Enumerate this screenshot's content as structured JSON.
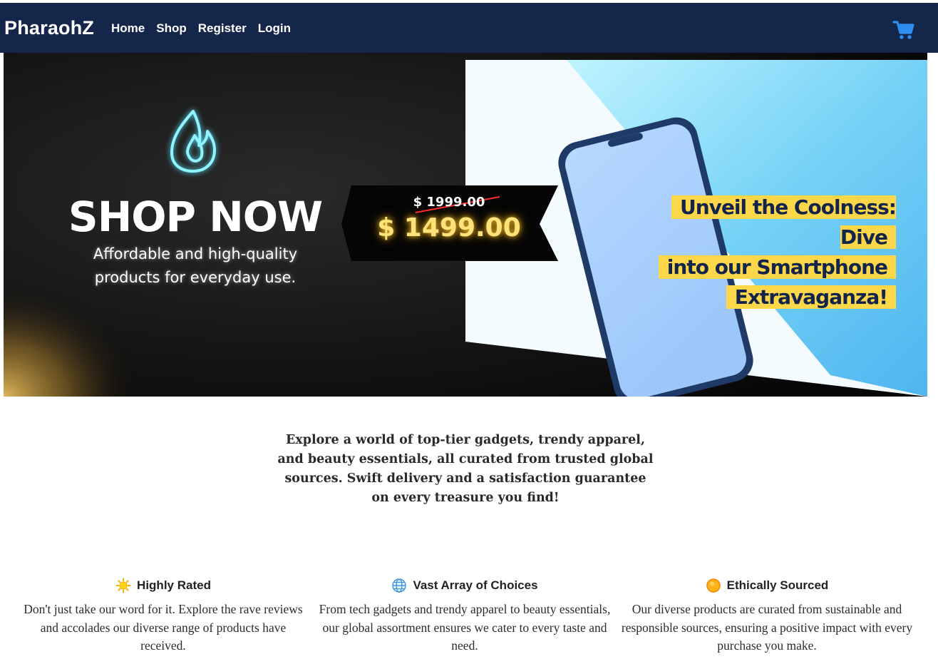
{
  "navbar": {
    "brand": "PharaohZ",
    "links": [
      "Home",
      "Shop",
      "Register",
      "Login"
    ],
    "cart_icon": "shopping-cart-icon",
    "background": "#14274a",
    "cart_color": "#2e8df1"
  },
  "hero": {
    "flame_icon": "flame-neon-icon",
    "heading": "SHOP NOW",
    "subtitle_lines": [
      "Affordable and high-quality",
      "products for everyday use."
    ],
    "old_price": "$ 1999.00",
    "new_price": "$ 1499.00",
    "promo_lines": [
      "Unveil the Coolness: Dive",
      "into our Smartphone",
      "Extravaganza!"
    ],
    "promo_highlight": "#fdd74a",
    "price_glow": "#ffe37a"
  },
  "intro": {
    "text": "Explore a world of top-tier gadgets, trendy apparel, and beauty essentials, all curated from trusted global sources. Swift delivery and a satisfaction guarantee on every treasure you find!"
  },
  "features": [
    {
      "icon": "sun-icon",
      "title": "Highly Rated",
      "body": "Don't just take our word for it. Explore the rave reviews and accolades our diverse range of products have received."
    },
    {
      "icon": "globe-icon",
      "title": "Vast Array of Choices",
      "body": "From tech gadgets and trendy apparel to beauty essentials, our global assortment ensures we cater to every taste and need."
    },
    {
      "icon": "orange-circle-icon",
      "title": "Ethically Sourced",
      "body": "Our diverse products are curated from sustainable and responsible sources, ensuring a positive impact with every purchase you make."
    }
  ]
}
